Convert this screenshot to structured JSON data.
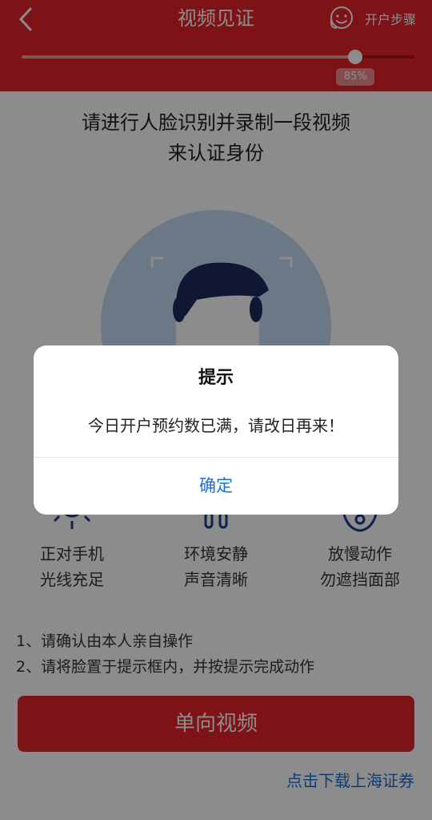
{
  "header": {
    "title": "视频见证",
    "steps_label": "开户步骤",
    "progress_percent": 85,
    "progress_label": "85%"
  },
  "instruction": {
    "line1": "请进行人脸识别并录制一段视频",
    "line2": "来认证身份"
  },
  "tips": [
    {
      "icon": "sun-icon",
      "line1": "正对手机",
      "line2": "光线充足"
    },
    {
      "icon": "headphone-icon",
      "line1": "环境安静",
      "line2": "声音清晰"
    },
    {
      "icon": "motion-icon",
      "line1": "放慢动作",
      "line2": "勿遮挡面部"
    }
  ],
  "notes": [
    "1、请确认由本人亲自操作",
    "2、请将脸置于提示框内，并按提示完成动作"
  ],
  "main_button": {
    "label": "单向视频"
  },
  "download_link": {
    "label": "点击下载上海证券"
  },
  "dialog": {
    "title": "提示",
    "message": "今日开户预约数已满，请改日再来！",
    "confirm_label": "确定"
  },
  "colors": {
    "brand_red": "#e3242b",
    "link_blue": "#1a6fd8"
  }
}
